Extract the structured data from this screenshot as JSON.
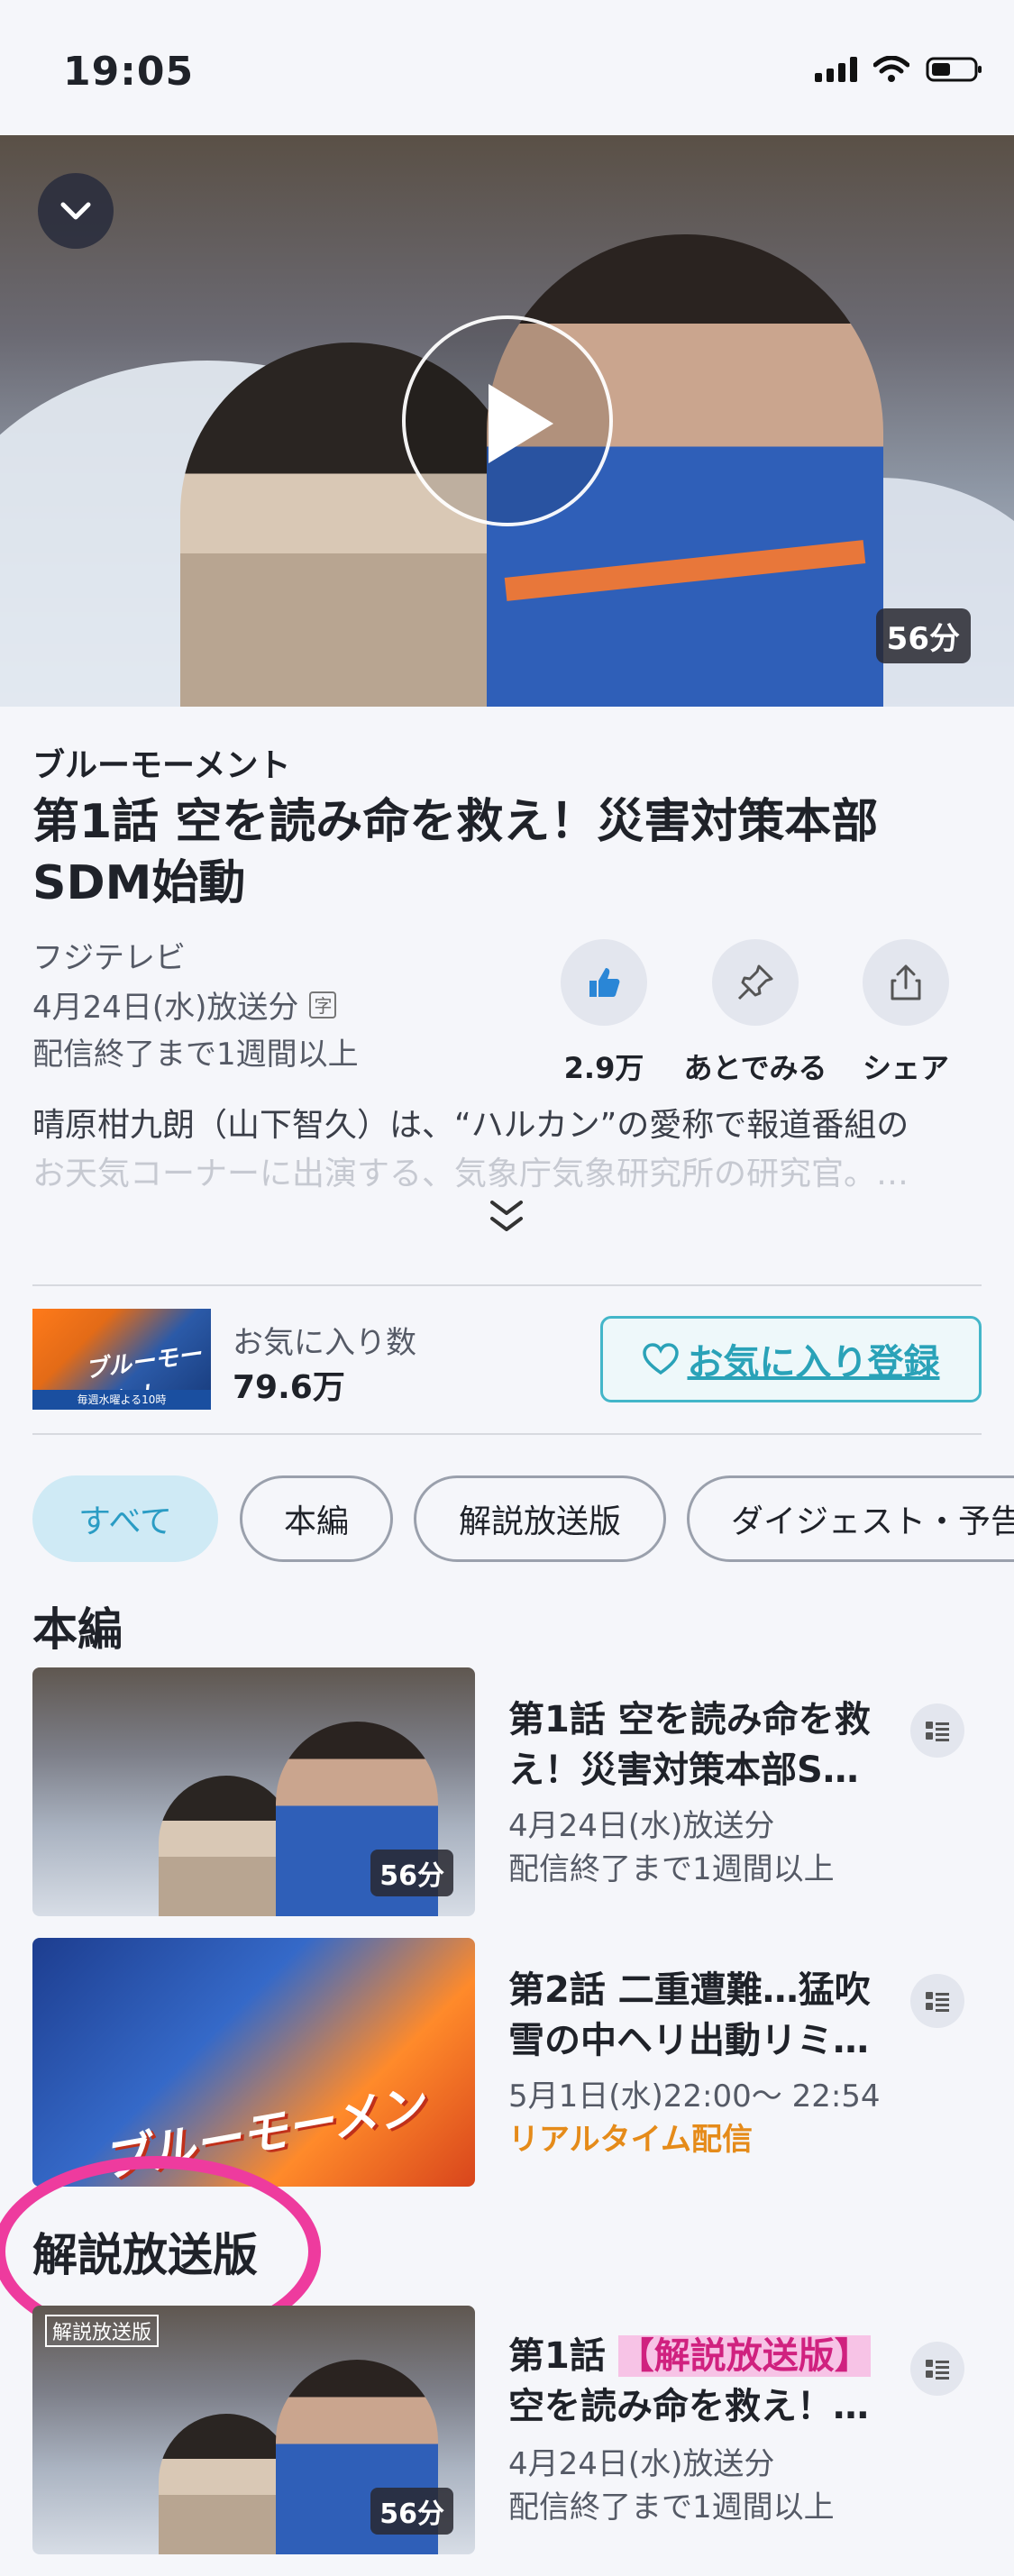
{
  "status_bar": {
    "time": "19:05"
  },
  "hero": {
    "duration": "56分"
  },
  "program": {
    "series": "ブルーモーメント",
    "title": "第1話 空を読み命を救え！災害対策本部SDM始動",
    "channel": "フジテレビ",
    "airdate": "4月24日(水)放送分",
    "cc": "字",
    "availability": "配信終了まで1週間以上",
    "description_line1": "晴原柑九朗（山下智久）は、“ハルカン”の愛称で報道番組の",
    "description_line2": "お天気コーナーに出演する、気象庁気象研究所の研究官。…"
  },
  "actions": [
    {
      "label": "2.9万",
      "icon": "thumbs-up-icon"
    },
    {
      "label": "あとでみる",
      "icon": "pin-icon"
    },
    {
      "label": "シェア",
      "icon": "share-icon"
    }
  ],
  "favorite": {
    "label": "お気に入り数",
    "count": "79.6万",
    "button_label": "お気に入り登録",
    "thumb_title": "ブルーモーメント",
    "thumb_ribbon": "毎週水曜よる10時"
  },
  "filters": [
    "すべて",
    "本編",
    "解説放送版",
    "ダイジェスト・予告"
  ],
  "sections": {
    "main": "本編",
    "audio_description": "解説放送版"
  },
  "episodes": [
    {
      "title": "第1話 空を読み命を救え！災害対策本部S…",
      "meta1": "4月24日(水)放送分",
      "meta2": "配信終了まで1週間以上",
      "duration": "56分"
    },
    {
      "title": "第2話 二重遭難…猛吹雪の中ヘリ出動リミ…",
      "meta1": "5月1日(水)22:00～ 22:54",
      "live": "リアルタイム配信",
      "poster_title": "ブルーモーメント"
    },
    {
      "title_prefix": "第1話 ",
      "title_highlight": "【解説放送版】",
      "title_rest": "空を読み命を救え！…",
      "meta1": "4月24日(水)放送分",
      "meta2": "配信終了まで1週間以上",
      "duration": "56分",
      "tag": "解説放送版"
    }
  ],
  "colors": {
    "accent": "#2aa2b8",
    "highlight_pink": "#ee3b9e",
    "live_orange": "#e58b1a"
  }
}
